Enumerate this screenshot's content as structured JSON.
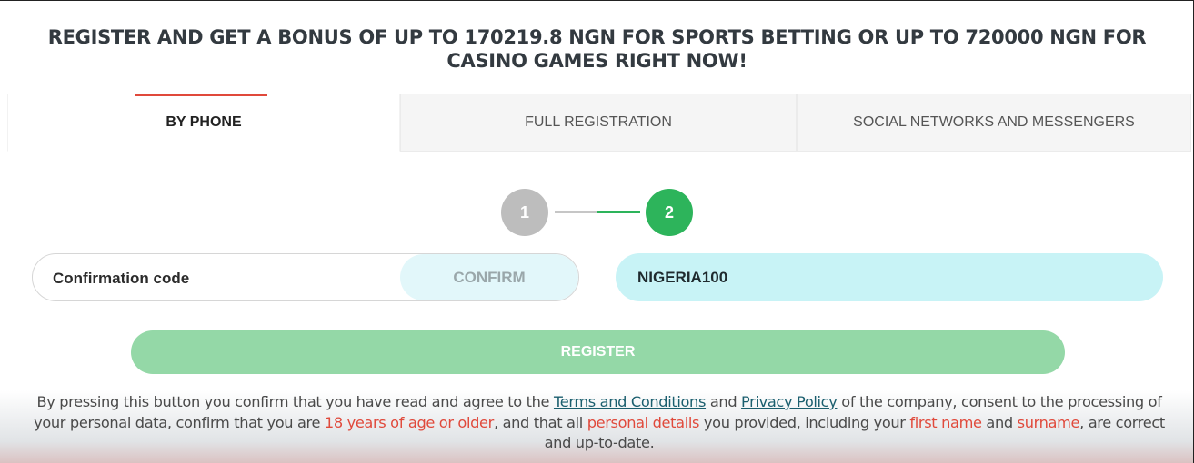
{
  "headline": "REGISTER AND GET A BONUS OF UP TO 170219.8 NGN FOR SPORTS BETTING OR UP TO 720000 NGN FOR CASINO GAMES RIGHT NOW!",
  "tabs": [
    {
      "label": "BY PHONE",
      "active": true
    },
    {
      "label": "FULL REGISTRATION",
      "active": false
    },
    {
      "label": "SOCIAL NETWORKS AND MESSENGERS",
      "active": false
    }
  ],
  "stepper": {
    "step1": "1",
    "step2": "2",
    "current_step": 2,
    "colors": {
      "inactive": "#bdbdbd",
      "active": "#2db45b"
    }
  },
  "confirmation": {
    "label": "Confirmation code",
    "button": "CONFIRM"
  },
  "promo_code": {
    "value": "NIGERIA100"
  },
  "register_button": "REGISTER",
  "legal": {
    "t1": "By pressing this button you confirm that you have read and agree to the ",
    "terms": "Terms and Conditions",
    "t2": " and ",
    "privacy": "Privacy Policy",
    "t3": " of the company, consent to the processing of your personal data, confirm that you are ",
    "age": "18 years of age or older",
    "t4": ", and that all ",
    "personal": "personal details",
    "t5": " you provided, including your ",
    "first_name": "first name",
    "t6": " and ",
    "surname": "surname",
    "t7": ", are correct and up-to-date."
  },
  "colors": {
    "accent_red": "#e0493b",
    "accent_green": "#2db45b",
    "register_green": "#94d8a7",
    "promo_cyan": "#c8f3f6",
    "link": "#1a5e6e"
  }
}
